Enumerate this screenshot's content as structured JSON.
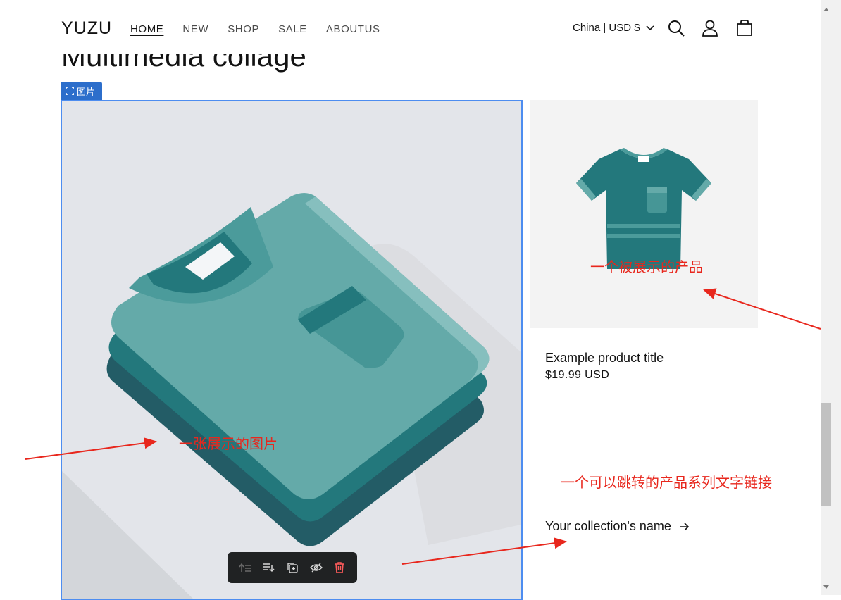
{
  "header": {
    "logo": "YUZU",
    "nav": [
      {
        "label": "HOME",
        "active": true
      },
      {
        "label": "NEW"
      },
      {
        "label": "SHOP"
      },
      {
        "label": "SALE"
      },
      {
        "label": "ABOUTUS"
      }
    ],
    "locale": "China | USD $",
    "icons": [
      "search-icon",
      "account-icon",
      "cart-icon"
    ]
  },
  "page": {
    "title": "Multimedia collage"
  },
  "editor": {
    "badge_label": "图片",
    "toolbar_icons": [
      "move-up-icon",
      "reorder-icon",
      "duplicate-icon",
      "hide-icon",
      "delete-icon"
    ]
  },
  "product": {
    "title": "Example product title",
    "price": "$19.99 USD"
  },
  "collection": {
    "link_label": "Your collection's name"
  },
  "annotations": {
    "product": "一个被展示的产品",
    "image": "一张展示的图片",
    "collection": "一个可以跳转的产品系列文字链接"
  },
  "colors": {
    "accent": "#2c6ecb",
    "annotation": "#e8271d",
    "teal_dark": "#235c66",
    "teal_mid": "#23787c",
    "teal_light": "#64aaa9"
  }
}
